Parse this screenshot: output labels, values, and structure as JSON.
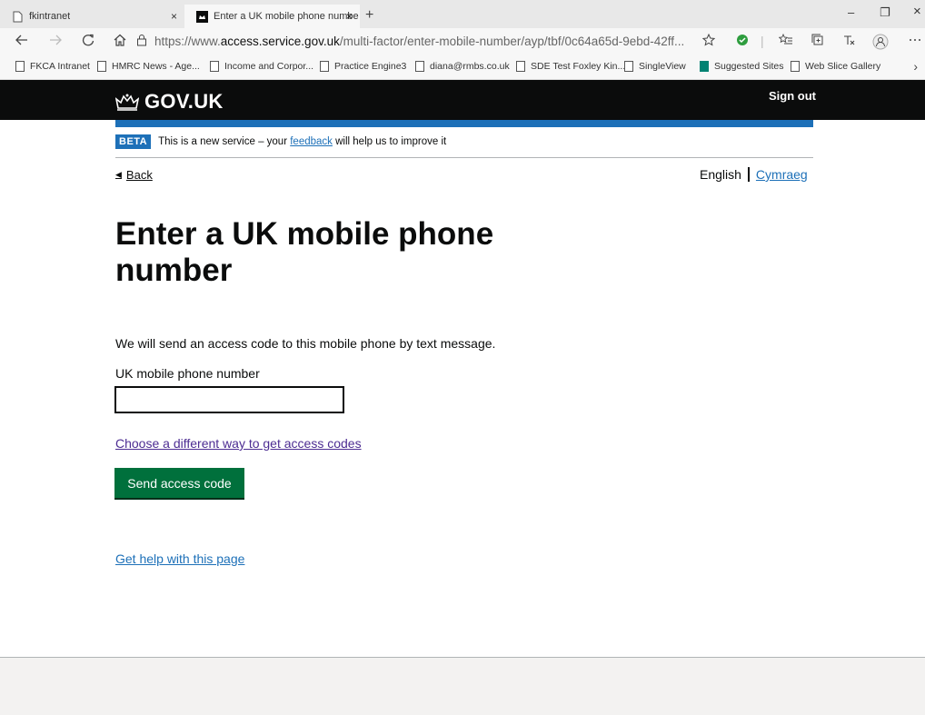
{
  "browser": {
    "tabs": [
      {
        "title": "fkintranet",
        "close": "×"
      },
      {
        "title": "Enter a UK mobile phone numbe",
        "close": "×"
      }
    ],
    "new_tab": "+",
    "window_controls": {
      "minimize": "–",
      "restore": "❐",
      "close": "×"
    },
    "url": {
      "prefix": "https://www.",
      "host": "access.service.gov.uk",
      "path": "/multi-factor/enter-mobile-number/ayp/tbf/0c64a65d-9ebd-42ff..."
    },
    "favorites": [
      {
        "label": "FKCA Intranet"
      },
      {
        "label": "HMRC News - Age..."
      },
      {
        "label": "Income and Corpor..."
      },
      {
        "label": "Practice Engine3"
      },
      {
        "label": "diana@rmbs.co.uk"
      },
      {
        "label": "SDE Test Foxley Kin..."
      },
      {
        "label": "SingleView"
      },
      {
        "label": "Suggested Sites"
      },
      {
        "label": "Web Slice Gallery"
      }
    ],
    "icons": {
      "back": "back-arrow-icon",
      "forward": "forward-arrow-icon",
      "refresh": "refresh-icon",
      "home": "home-icon",
      "lock": "lock-icon",
      "star": "star-icon",
      "shield": "shield-check-icon",
      "favorites": "favorites-icon",
      "collections": "collections-icon",
      "read_aloud": "read-aloud-icon",
      "profile": "profile-icon",
      "more": "more-icon"
    }
  },
  "header": {
    "logo_text": "GOV.UK",
    "sign_out": "Sign out"
  },
  "beta": {
    "tag": "BETA",
    "text_before": "This is a new service – your ",
    "link": "feedback",
    "text_after": " will help us to improve it"
  },
  "nav": {
    "back": "Back",
    "lang_current": "English",
    "lang_other": "Cymraeg"
  },
  "main": {
    "title": "Enter a UK mobile phone number",
    "hint": "We will send an access code to this mobile phone by text message.",
    "field_label": "UK mobile phone number",
    "field_value": "",
    "alt_link": "Choose a different way to get access codes",
    "submit": "Send access code",
    "help_link": "Get help with this page"
  },
  "colors": {
    "header_bg": "#0b0c0c",
    "brand_blue": "#1d70b8",
    "button_green": "#00703c",
    "visited_link": "#4c2c92",
    "footer_bg": "#f3f2f1"
  }
}
